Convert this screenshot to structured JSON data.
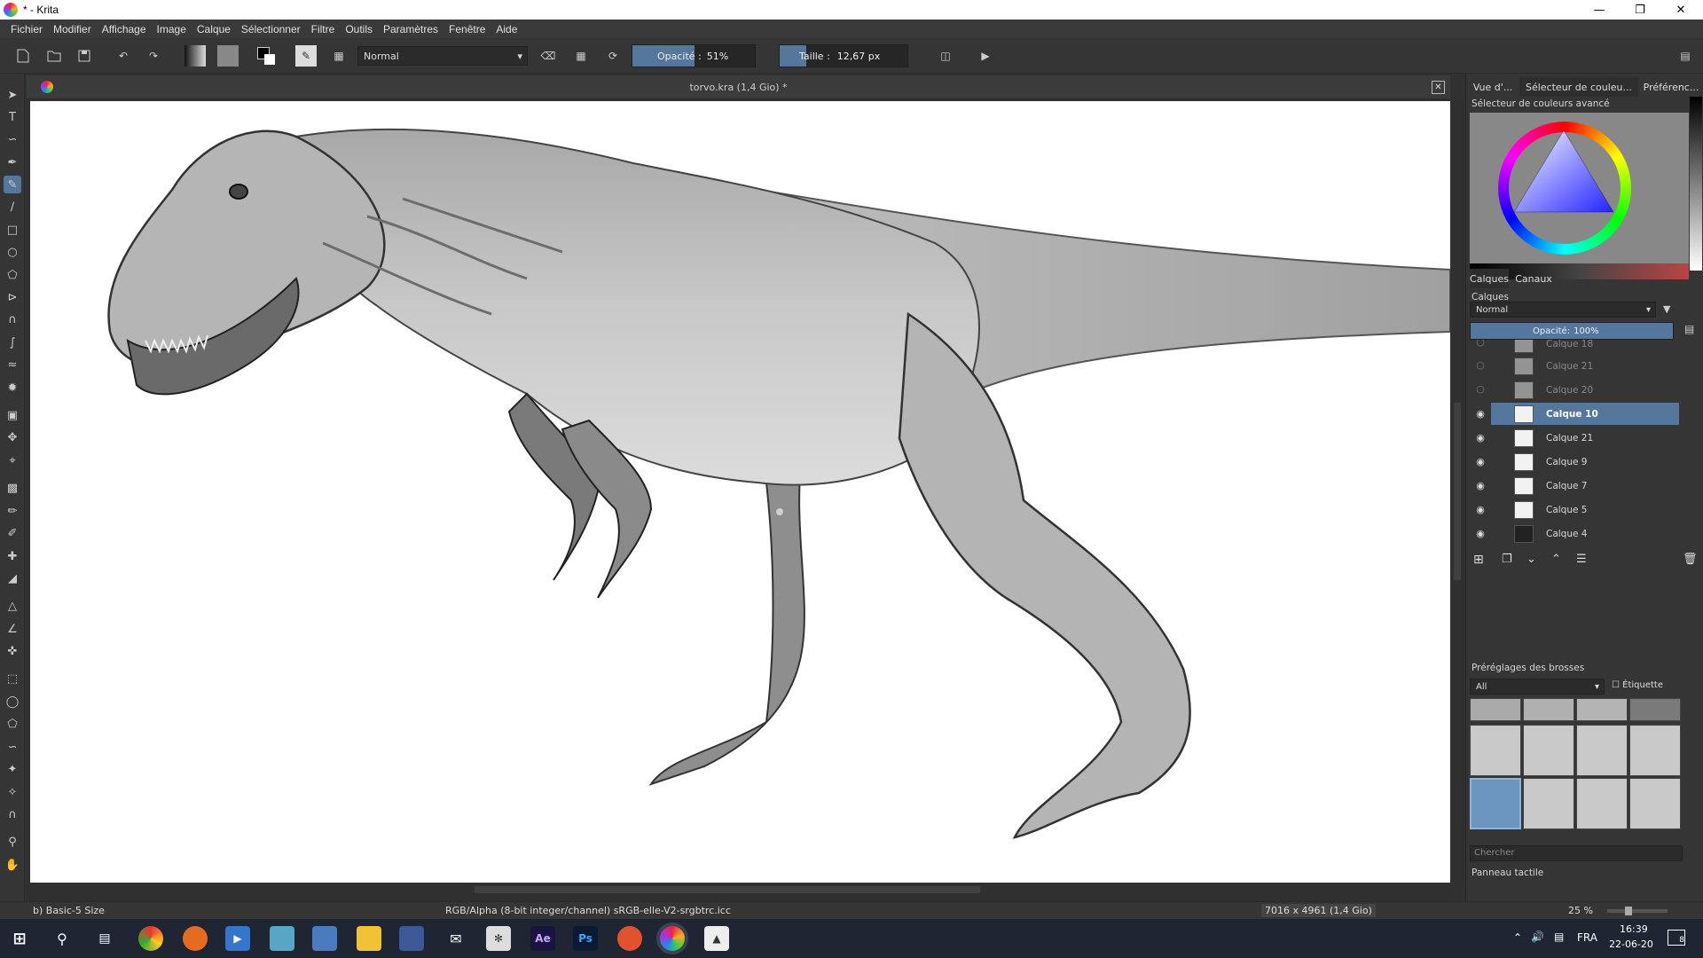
{
  "window": {
    "title": "* - Krita"
  },
  "menu": [
    "Fichier",
    "Modifier",
    "Affichage",
    "Image",
    "Calque",
    "Sélectionner",
    "Filtre",
    "Outils",
    "Paramètres",
    "Fenêtre",
    "Aide"
  ],
  "toolbar": {
    "blend_mode": "Normal",
    "opacity_label": "Opacité :",
    "opacity_value": "51%",
    "opacity_fraction": 0.51,
    "size_label": "Taille :",
    "size_value": "12,67 px"
  },
  "document": {
    "tab_title": "torvo.kra (1,4 Gio) *"
  },
  "docker": {
    "tabs": [
      "Vue d'...",
      "Sélecteur de couleu...",
      "Préférenc..."
    ],
    "color_panel_title": "Sélecteur de couleurs avancé",
    "layer_tabs": [
      "Calques",
      "Canaux"
    ],
    "layers_title": "Calques",
    "layer_blend": "Normal",
    "layer_opacity_label": "Opacité:",
    "layer_opacity_value": "100%",
    "layers": [
      {
        "name": "Calque 18",
        "visible": false,
        "selected": false
      },
      {
        "name": "Calque 21",
        "visible": false,
        "selected": false
      },
      {
        "name": "Calque 20",
        "visible": false,
        "selected": false
      },
      {
        "name": "Calque 10",
        "visible": true,
        "selected": true
      },
      {
        "name": "Calque 21",
        "visible": true,
        "selected": false
      },
      {
        "name": "Calque 9",
        "visible": true,
        "selected": false
      },
      {
        "name": "Calque 7",
        "visible": true,
        "selected": false
      },
      {
        "name": "Calque 5",
        "visible": true,
        "selected": false
      },
      {
        "name": "Calque 4",
        "visible": true,
        "selected": false
      }
    ],
    "brush_title": "Préréglages des brosses",
    "brush_filter": "All",
    "brush_tag": "Étiquette",
    "brush_search_placeholder": "Chercher",
    "touch_panel": "Panneau tactile"
  },
  "status": {
    "brush": "b) Basic-5 Size",
    "colorspace": "RGB/Alpha (8-bit integer/channel)  sRGB-elle-V2-srgbtrc.icc",
    "dimensions": "7016 x 4961 (1,4 Gio)",
    "zoom": "25 %"
  },
  "taskbar": {
    "language": "FRA",
    "time": "16:39",
    "date": "22-06-20",
    "ae_label": "Ae",
    "ps_label": "Ps",
    "notif_count": "8"
  }
}
